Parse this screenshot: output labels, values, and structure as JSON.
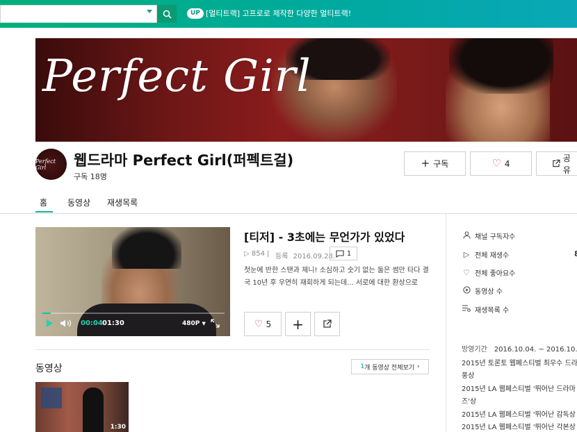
{
  "topbar": {
    "up_badge": "UP",
    "promo_text": "[멀티트랙] 고프로로 제작한 다양한 멀티트랙!"
  },
  "banner": {
    "title": "Perfect Girl"
  },
  "channel": {
    "avatar_text": "Perfect Girl",
    "title": "웹드라마 Perfect Girl(퍼펙트걸)",
    "subscribers": "구독 18명",
    "subscribe_label": "구독",
    "like_count": "4",
    "share_label": "공유"
  },
  "tabs": [
    {
      "label": "홈",
      "active": true
    },
    {
      "label": "동영상",
      "active": false
    },
    {
      "label": "재생목록",
      "active": false
    }
  ],
  "featured": {
    "title": "[티저] - 3초에는 무언가가 있었다",
    "plays": "854",
    "date_label": "등록",
    "date": "2016.09.28.",
    "comments": "1",
    "description": "첫눈에 반한 스탠과 제니! 소심하고 숫기 없는 둘은 썸만 타다 결국 10년 후 우연히 재회하게 되는데... 서로에 대한 환상으로",
    "likes": "5",
    "player": {
      "current_time": "00:04",
      "duration": "01:30",
      "quality": "480P",
      "progress": 0.045
    }
  },
  "videos_section": {
    "title": "동영상",
    "view_all_count": "1",
    "view_all_label": "개 동영상 전체보기",
    "items": [
      {
        "duration": "1:30"
      }
    ]
  },
  "sidebar": {
    "stats": [
      {
        "icon": "person-icon",
        "label": "채널 구독자수"
      },
      {
        "icon": "play-icon",
        "label": "전체 재생수"
      },
      {
        "icon": "heart-icon",
        "label": "전체 좋아요수"
      },
      {
        "icon": "circle-play-icon",
        "label": "동영상 수"
      },
      {
        "icon": "playlist-icon",
        "label": "재생목록 수"
      }
    ],
    "partial_value": "8",
    "period_label": "방영기간",
    "period_value": "2016.10.04. ~ 2016.10.",
    "awards": [
      "2015년 토론토 웹페스티벌 최우수 드라",
      "풍상",
      "2015년 LA 웹페스티벌 '뛰어난 드라마",
      "즈'상",
      "2015년 LA 웹페스티벌 '뛰어난 감독상",
      "2015년 LA 웹페스티벌 '뛰어난 각본상"
    ]
  },
  "colors": {
    "accent": "#10b39a",
    "topbar_start": "#00b07a",
    "topbar_end": "#0aa8b8",
    "like_heart": "#e0405a"
  }
}
